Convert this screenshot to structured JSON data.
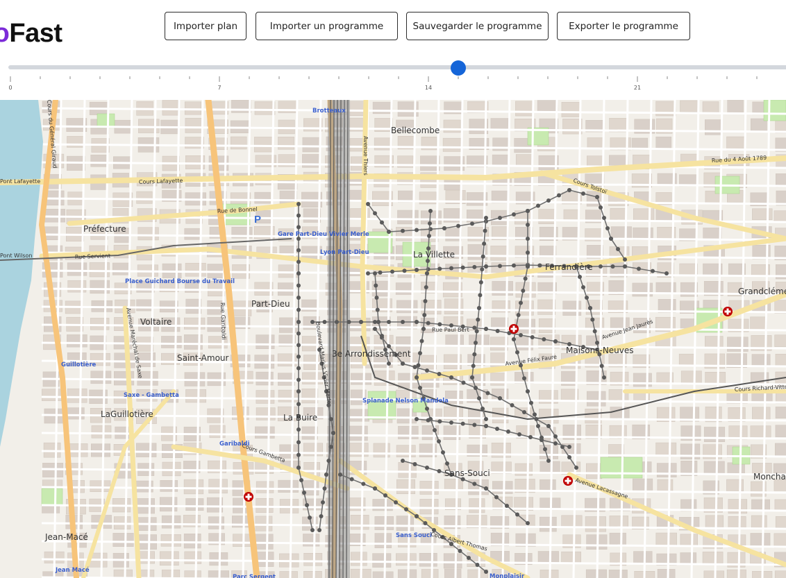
{
  "app": {
    "logo_part1": "eo",
    "logo_part2": "Fast"
  },
  "toolbar": {
    "import_plan": "Importer plan",
    "import_program": "Importer un programme",
    "save_program": "Sauvegarder le programme",
    "export_program": "Exporter le programme"
  },
  "timeline": {
    "min": 0,
    "max": 26,
    "value": 15,
    "major_ticks": [
      {
        "value": 0,
        "label": "0"
      },
      {
        "value": 7,
        "label": "7"
      },
      {
        "value": 14,
        "label": "14"
      },
      {
        "value": 21,
        "label": "21"
      }
    ]
  },
  "map": {
    "districts": [
      "Préfecture",
      "La Villette",
      "Ferrandière",
      "Part-Dieu",
      "Voltaire",
      "Saint-Amour",
      "3e Arrondissement",
      "Maisons-Neuves",
      "La Buire",
      "LaGuillotière",
      "Sans-Souci",
      "Jean-Macé",
      "Bellecombe",
      "Grandclément",
      "Monchat"
    ],
    "streets": [
      "Pont Lafayette",
      "Cours Lafayette",
      "Rue de Bonnel",
      "Rue Servient",
      "Pont Wilson",
      "Avenue Thiers",
      "Cours Tolstoï",
      "Rue du 4 Août 1789",
      "Avenue Félix Faure",
      "Cours Gambetta",
      "Cours Albert Thomas",
      "Avenue Lacassagne",
      "Rue Garibaldi",
      "Avenue Maréchal de Saxe",
      "Rue Paul Bert",
      "Cours Richard-Vitton",
      "Avenue Jean Jaurès",
      "Boulevard Marius Vivier Merle",
      "Cours du Général Giraud"
    ],
    "pois": [
      "Gare Part-Dieu Vivier Merle",
      "Lyon Part-Dieu",
      "Place Guichard Bourse du Travail",
      "Guillotière",
      "Saxe - Gambetta",
      "Garibaldi",
      "Sans Souci",
      "Brotteaux",
      "Splanade Nelson Mandela",
      "Parc Sergent",
      "Jean Macé",
      "Monplaisir"
    ],
    "parking_symbol": "P",
    "colors": {
      "river": "#a9cfe8",
      "primary_road": "#f7d28a",
      "secondary_road": "#f6f6b0",
      "park": "#cdebb0",
      "rail": "#666666",
      "route_point": "#555555",
      "hospital": "#c00000"
    }
  }
}
